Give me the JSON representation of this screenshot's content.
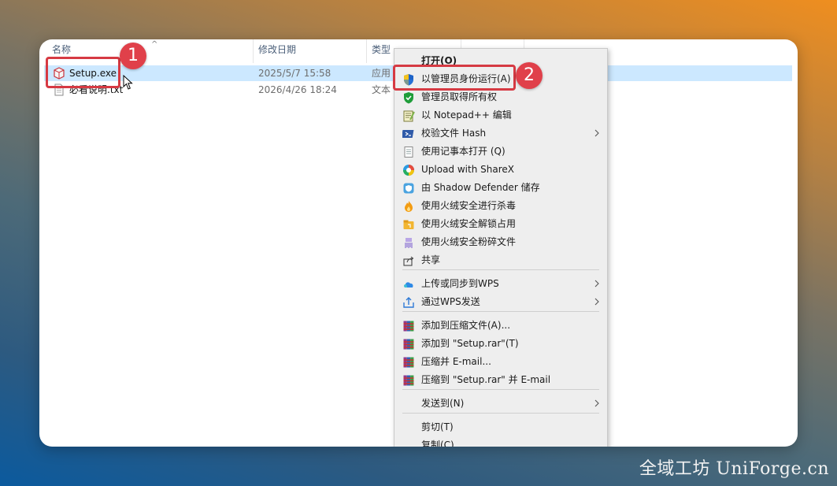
{
  "explorer": {
    "columns": {
      "name": "名称",
      "date": "修改日期",
      "type": "类型",
      "sort_indicator": "^"
    },
    "files": [
      {
        "name": "Setup.exe",
        "date": "2025/5/7 15:58",
        "type": "应用",
        "icon": "setup-exe-icon",
        "selected": true
      },
      {
        "name": "必看说明.txt",
        "date": "2026/4/26 18:24",
        "type": "文本",
        "icon": "text-file-icon",
        "selected": false
      }
    ]
  },
  "context_menu": {
    "items": [
      {
        "label": "打开(O)",
        "icon": "",
        "bold": true
      },
      {
        "label": "以管理员身份运行(A)",
        "icon": "uac-shield-icon"
      },
      {
        "label": "管理员取得所有权",
        "icon": "green-shield-icon"
      },
      {
        "label": "以 Notepad++ 编辑",
        "icon": "notepad-plus-plus-icon"
      },
      {
        "label": "校验文件 Hash",
        "icon": "powershell-icon",
        "submenu": true
      },
      {
        "label": "使用记事本打开 (Q)",
        "icon": "notepad-icon"
      },
      {
        "label": "Upload with ShareX",
        "icon": "sharex-icon"
      },
      {
        "label": "由 Shadow Defender 储存",
        "icon": "shadow-defender-icon"
      },
      {
        "label": "使用火绒安全进行杀毒",
        "icon": "huorong-flame-icon"
      },
      {
        "label": "使用火绒安全解锁占用",
        "icon": "huorong-unlock-icon"
      },
      {
        "label": "使用火绒安全粉碎文件",
        "icon": "huorong-shred-icon"
      },
      {
        "label": "共享",
        "icon": "share-icon"
      },
      {
        "label": "上传或同步到WPS",
        "icon": "wps-cloud-icon",
        "submenu": true
      },
      {
        "label": "通过WPS发送",
        "icon": "wps-send-icon",
        "submenu": true
      },
      {
        "label": "添加到压缩文件(A)...",
        "icon": "winrar-icon"
      },
      {
        "label": "添加到 \"Setup.rar\"(T)",
        "icon": "winrar-icon"
      },
      {
        "label": "压缩并 E-mail...",
        "icon": "winrar-icon"
      },
      {
        "label": "压缩到 \"Setup.rar\" 并 E-mail",
        "icon": "winrar-icon"
      },
      {
        "label": "发送到(N)",
        "icon": "",
        "submenu": true
      },
      {
        "label": "剪切(T)",
        "icon": ""
      },
      {
        "label": "复制(C)",
        "icon": ""
      }
    ]
  },
  "annotations": {
    "step1": "1",
    "step2": "2"
  },
  "watermark": "全域工坊 UniForge.cn",
  "colors": {
    "selection": "#cce8ff",
    "callout": "#d63a43",
    "badge": "#e0404a",
    "menu_bg": "#eeeeee"
  }
}
